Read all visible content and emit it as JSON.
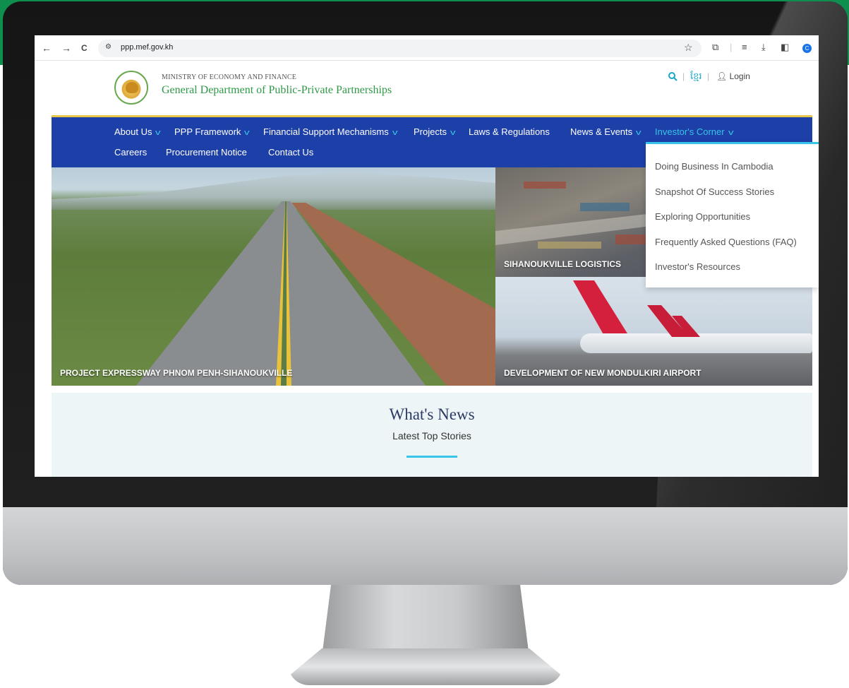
{
  "browser": {
    "back": "←",
    "forward": "→",
    "reload": "C",
    "site_info": "⚙",
    "url": "ppp.mef.gov.kh",
    "star": "☆",
    "profile_initial": "C"
  },
  "header": {
    "ministry": "MINISTRY OF ECONOMY AND FINANCE",
    "department": "General Department of Public-Private Partnerships",
    "language": "ខ្មែរ",
    "login": "Login"
  },
  "nav": {
    "row1": [
      {
        "label": "About Us",
        "has_dropdown": true
      },
      {
        "label": "PPP Framework",
        "has_dropdown": true
      },
      {
        "label": "Financial Support Mechanisms",
        "has_dropdown": true
      },
      {
        "label": "Projects",
        "has_dropdown": true
      },
      {
        "label": "Laws & Regulations",
        "has_dropdown": false
      },
      {
        "label": "News & Events",
        "has_dropdown": true
      },
      {
        "label": "Investor's Corner",
        "has_dropdown": true,
        "active": true
      }
    ],
    "row2": [
      {
        "label": "Careers"
      },
      {
        "label": "Procurement Notice"
      },
      {
        "label": "Contact Us"
      }
    ]
  },
  "dropdown": {
    "items": [
      "Doing Business In Cambodia",
      "Snapshot Of Success Stories",
      "Exploring Opportunities",
      "Frequently Asked Questions (FAQ)",
      "Investor's Resources"
    ]
  },
  "hero": {
    "left_caption": "PROJECT EXPRESSWAY PHNOM PENH-SIHANOUKVILLE",
    "right_top_caption": "SIHANOUKVILLE LOGISTICS",
    "right_bottom_caption": "DEVELOPMENT OF NEW MONDULKIRI AIRPORT"
  },
  "news": {
    "title": "What's News",
    "subtitle": "Latest Top Stories"
  },
  "colors": {
    "navbar": "#1d3fa8",
    "accent": "#37c4e8",
    "department_green": "#2e9a47",
    "nav_border": "#e7c64a"
  }
}
